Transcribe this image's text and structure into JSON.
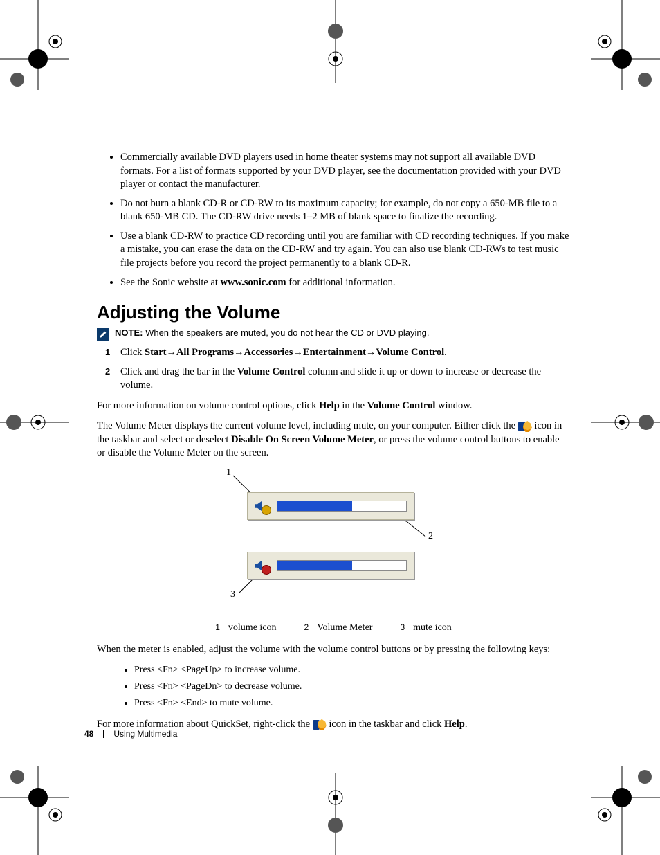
{
  "bullets_intro": [
    "Commercially available DVD players used in home theater systems may not support all available DVD formats. For a list of formats supported by your DVD player, see the documentation provided with your DVD player or contact the manufacturer.",
    "Do not burn a blank CD-R or CD-RW to its maximum capacity; for example, do not copy a 650-MB file to a blank 650-MB CD. The CD-RW drive needs 1–2 MB of blank space to finalize the recording.",
    "Use a blank CD-RW to practice CD recording until you are familiar with CD recording techniques. If you make a mistake, you can erase the data on the CD-RW and try again. You can also use blank CD-RWs to test music file projects before you record the project permanently to a blank CD-R."
  ],
  "bullet_sonic_pre": "See the Sonic website at ",
  "bullet_sonic_url": "www.sonic.com",
  "bullet_sonic_post": " for additional information.",
  "section_title": "Adjusting the Volume",
  "note_label": "NOTE: ",
  "note_text": "When the speakers are muted, you do not hear the CD or DVD playing.",
  "step1_pre": "Click ",
  "step1_path": "Start→All Programs→Accessories→Entertainment→Volume Control",
  "step1_post": ".",
  "step2_pre": "Click and drag the bar in the ",
  "step2_bold": "Volume Control",
  "step2_post": " column and slide it up or down to increase or decrease the volume.",
  "para_moreinfo_pre": "For more information on volume control options, click ",
  "para_moreinfo_b1": "Help",
  "para_moreinfo_mid": " in the ",
  "para_moreinfo_b2": "Volume Control",
  "para_moreinfo_post": " window.",
  "para_meter_pre": "The Volume Meter displays the current volume level, including mute, on your computer. Either click the ",
  "para_meter_mid": " icon in the taskbar and select or deselect ",
  "para_meter_bold": "Disable On Screen Volume Meter",
  "para_meter_post": ", or press the volume control buttons to enable or disable the Volume Meter on the screen.",
  "diagram": {
    "c1": "1",
    "c2": "2",
    "c3": "3",
    "bar_fill_pct": "58%"
  },
  "legend": {
    "n1": "1",
    "t1": "volume icon",
    "n2": "2",
    "t2": "Volume Meter",
    "n3": "3",
    "t3": "mute icon"
  },
  "para_keys_intro": "When the meter is enabled, adjust the volume with the volume control buttons or by pressing the following keys:",
  "keys": [
    "Press <Fn> <PageUp> to increase volume.",
    "Press <Fn> <PageDn> to decrease volume.",
    "Press <Fn> <End> to mute volume."
  ],
  "para_qs_pre": "For more information about QuickSet, right-click the ",
  "para_qs_mid": " icon in the taskbar and click ",
  "para_qs_bold": "Help",
  "para_qs_post": ".",
  "footer": {
    "page": "48",
    "section": "Using Multimedia"
  }
}
